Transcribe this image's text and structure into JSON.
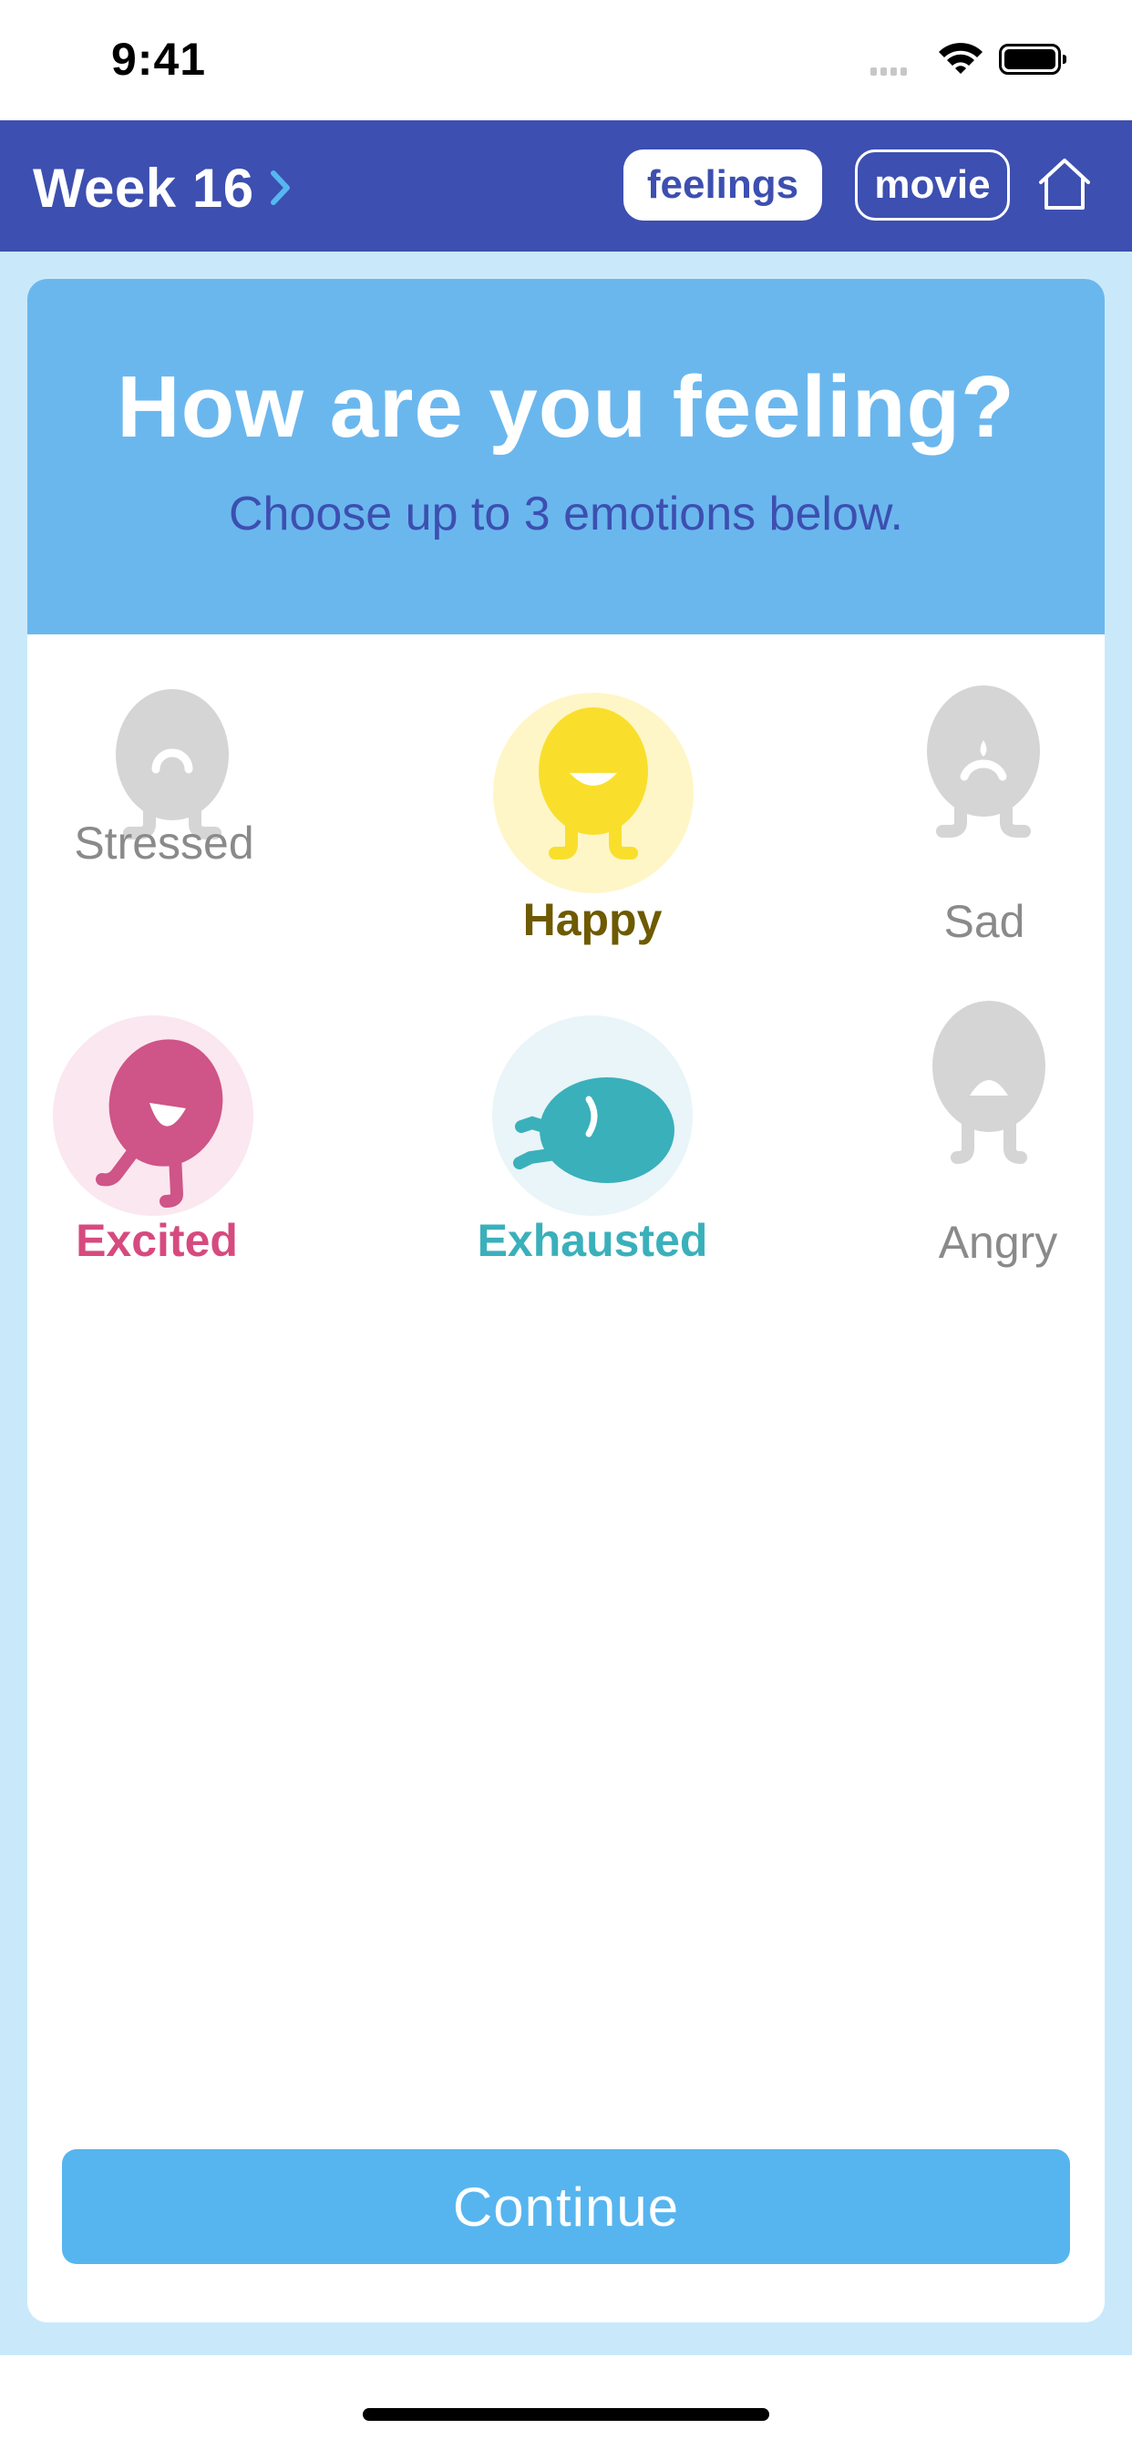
{
  "status_bar": {
    "time": "9:41"
  },
  "nav": {
    "week_label": "Week 16",
    "tabs": {
      "feelings": "feelings",
      "movie": "movie"
    },
    "home_icon": "home-icon"
  },
  "header": {
    "title": "How are you feeling?",
    "subtitle": "Choose up to 3 emotions below."
  },
  "emotions": [
    {
      "label": "Stressed",
      "selected": false,
      "color": "#8a8a8a"
    },
    {
      "label": "Happy",
      "selected": true,
      "color": "#6e5a00"
    },
    {
      "label": "Sad",
      "selected": false,
      "color": "#8a8a8a"
    },
    {
      "label": "Excited",
      "selected": true,
      "color": "#d64a7f"
    },
    {
      "label": "Exhausted",
      "selected": true,
      "color": "#3ab0bb"
    },
    {
      "label": "Angry",
      "selected": false,
      "color": "#8a8a8a"
    }
  ],
  "colors": {
    "nav": "#3d4fb0",
    "header": "#6ab7ee",
    "background": "#c9e9fb",
    "button": "#56b5ef"
  },
  "continue_label": "Continue"
}
